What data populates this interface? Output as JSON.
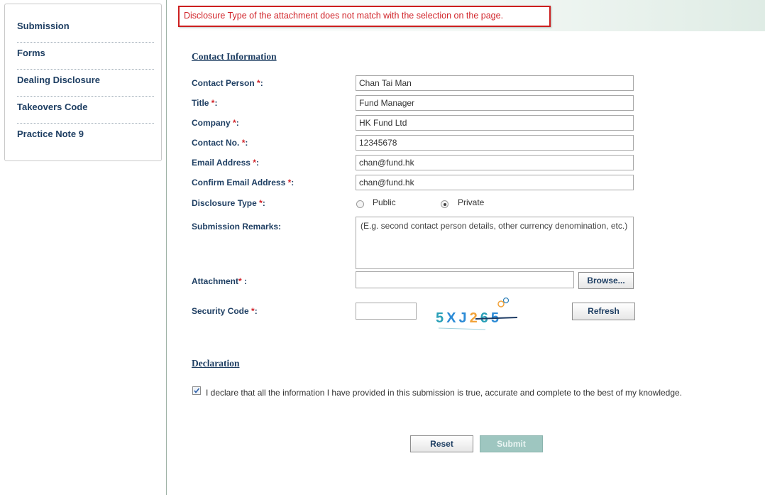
{
  "sidebar": {
    "items": [
      {
        "label": "Submission"
      },
      {
        "label": "Forms"
      },
      {
        "label": "Dealing Disclosure"
      },
      {
        "label": "Takeovers Code"
      },
      {
        "label": "Practice Note 9"
      }
    ]
  },
  "error": {
    "message": "Disclosure Type of the attachment does not match with the selection on the page."
  },
  "contact": {
    "section_title": "Contact Information",
    "required_mark": "*",
    "fields": {
      "contact_person": {
        "label": "Contact Person",
        "value": "Chan Tai Man"
      },
      "title": {
        "label": "Title",
        "value": "Fund Manager"
      },
      "company": {
        "label": "Company",
        "value": "HK Fund Ltd"
      },
      "contact_no": {
        "label": "Contact No.",
        "value": "12345678"
      },
      "email": {
        "label": "Email Address",
        "value": "chan@fund.hk"
      },
      "confirm_email": {
        "label": "Confirm Email Address",
        "value": "chan@fund.hk"
      }
    },
    "disclosure_type": {
      "label": "Disclosure Type",
      "options": [
        "Public",
        "Private"
      ],
      "selected": "Private"
    },
    "remarks": {
      "label": "Submission Remarks:",
      "placeholder": "(E.g. second contact person details, other currency denomination, etc.)"
    },
    "attachment": {
      "label": "Attachment",
      "browse_label": "Browse..."
    },
    "security_code": {
      "label": "Security Code",
      "captcha_text": "5XJ265",
      "refresh_label": "Refresh"
    }
  },
  "declaration": {
    "section_title": "Declaration",
    "checked": true,
    "text": "I declare that all the information I have provided in this submission is true, accurate and complete to the best of my knowledge."
  },
  "actions": {
    "reset_label": "Reset",
    "submit_label": "Submit"
  },
  "colors": {
    "label_navy": "#1f3f63",
    "error_red": "#d1242a",
    "submit_disabled": "#9ec6c0"
  }
}
